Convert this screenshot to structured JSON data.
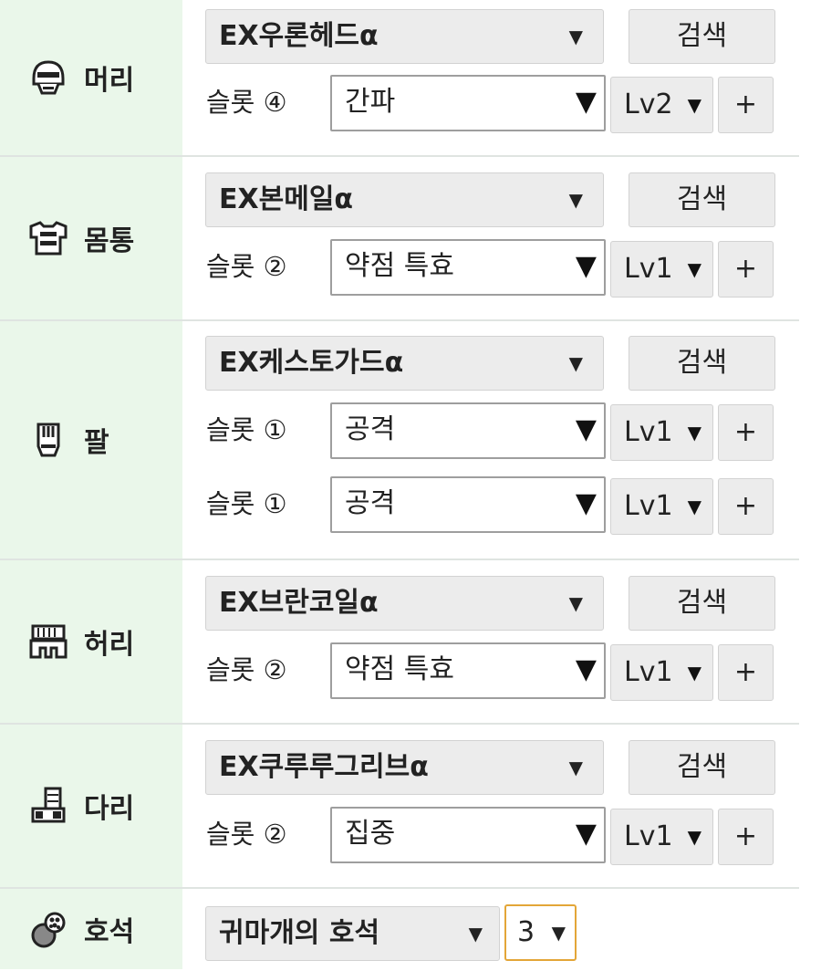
{
  "rows": [
    {
      "label": "머리",
      "icon": "helmet-icon",
      "equipment": "EX우론헤드α",
      "search_label": "검색",
      "slots": [
        {
          "slot_label": "슬롯 ④",
          "skill": "간파",
          "level": "Lv2",
          "add_label": "+"
        }
      ]
    },
    {
      "label": "몸통",
      "icon": "chest-armor-icon",
      "equipment": "EX본메일α",
      "search_label": "검색",
      "slots": [
        {
          "slot_label": "슬롯 ②",
          "skill": "약점 특효",
          "level": "Lv1",
          "add_label": "+"
        }
      ]
    },
    {
      "label": "팔",
      "icon": "gauntlet-icon",
      "equipment": "EX케스토가드α",
      "search_label": "검색",
      "slots": [
        {
          "slot_label": "슬롯 ①",
          "skill": "공격",
          "level": "Lv1",
          "add_label": "+"
        },
        {
          "slot_label": "슬롯 ①",
          "skill": "공격",
          "level": "Lv1",
          "add_label": "+"
        }
      ]
    },
    {
      "label": "허리",
      "icon": "waist-armor-icon",
      "equipment": "EX브란코일α",
      "search_label": "검색",
      "slots": [
        {
          "slot_label": "슬롯 ②",
          "skill": "약점 특효",
          "level": "Lv1",
          "add_label": "+"
        }
      ]
    },
    {
      "label": "다리",
      "icon": "greaves-icon",
      "equipment": "EX쿠루루그리브α",
      "search_label": "검색",
      "slots": [
        {
          "slot_label": "슬롯 ②",
          "skill": "집중",
          "level": "Lv1",
          "add_label": "+"
        }
      ]
    }
  ],
  "charm": {
    "label": "호석",
    "icon": "charm-icon",
    "name": "귀마개의 호석",
    "slot_value": "3"
  },
  "dropdown_arrow": "▼",
  "colors": {
    "label_bg": "#eaf7ea",
    "button_bg": "#ececec",
    "charm_slot_border": "#e3a638"
  }
}
